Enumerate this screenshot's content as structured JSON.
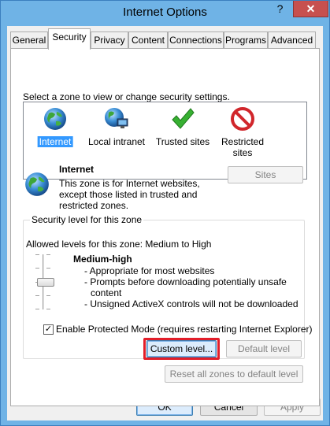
{
  "window": {
    "title": "Internet Options",
    "help_icon": "question-mark-icon",
    "help_glyph": "?",
    "close_icon": "close-x-icon",
    "close_glyph": "✕"
  },
  "tabs": [
    {
      "label": "General"
    },
    {
      "label": "Security"
    },
    {
      "label": "Privacy"
    },
    {
      "label": "Content"
    },
    {
      "label": "Connections"
    },
    {
      "label": "Programs"
    },
    {
      "label": "Advanced"
    }
  ],
  "active_tab": "Security",
  "zones_prompt": "Select a zone to view or change security settings.",
  "zones": [
    {
      "label": "Internet",
      "icon": "globe-icon",
      "selected": true
    },
    {
      "label": "Local intranet",
      "icon": "intranet-globe-icon",
      "selected": false
    },
    {
      "label": "Trusted sites",
      "icon": "green-check-icon",
      "selected": false
    },
    {
      "label_line1": "Restricted",
      "label_line2": "sites",
      "icon": "restricted-icon",
      "selected": false
    }
  ],
  "zone_detail": {
    "title": "Internet",
    "line1": "This zone is for Internet websites,",
    "line2": "except those listed in trusted and",
    "line3": "restricted zones.",
    "sites_button": "Sites"
  },
  "security_level": {
    "group_title": "Security level for this zone",
    "allowed": "Allowed levels for this zone: Medium to High",
    "level_name": "Medium-high",
    "bullet1": "- Appropriate for most websites",
    "bullet2a": "- Prompts before downloading potentially unsafe",
    "bullet2b": "content",
    "bullet3": "- Unsigned ActiveX controls will not be downloaded",
    "protected_mode_label": "Enable Protected Mode (requires restarting Internet Explorer)",
    "protected_mode_checked": true,
    "check_glyph": "✓",
    "custom_level_button": "Custom level...",
    "default_level_button": "Default level"
  },
  "reset_all_button": "Reset all zones to default level",
  "footer": {
    "ok": "OK",
    "cancel": "Cancel",
    "apply": "Apply"
  },
  "colors": {
    "highlight_border": "#e21e2a",
    "selection": "#3399ff",
    "title_bar": "#6fb3e6",
    "close_button": "#c7504f"
  }
}
